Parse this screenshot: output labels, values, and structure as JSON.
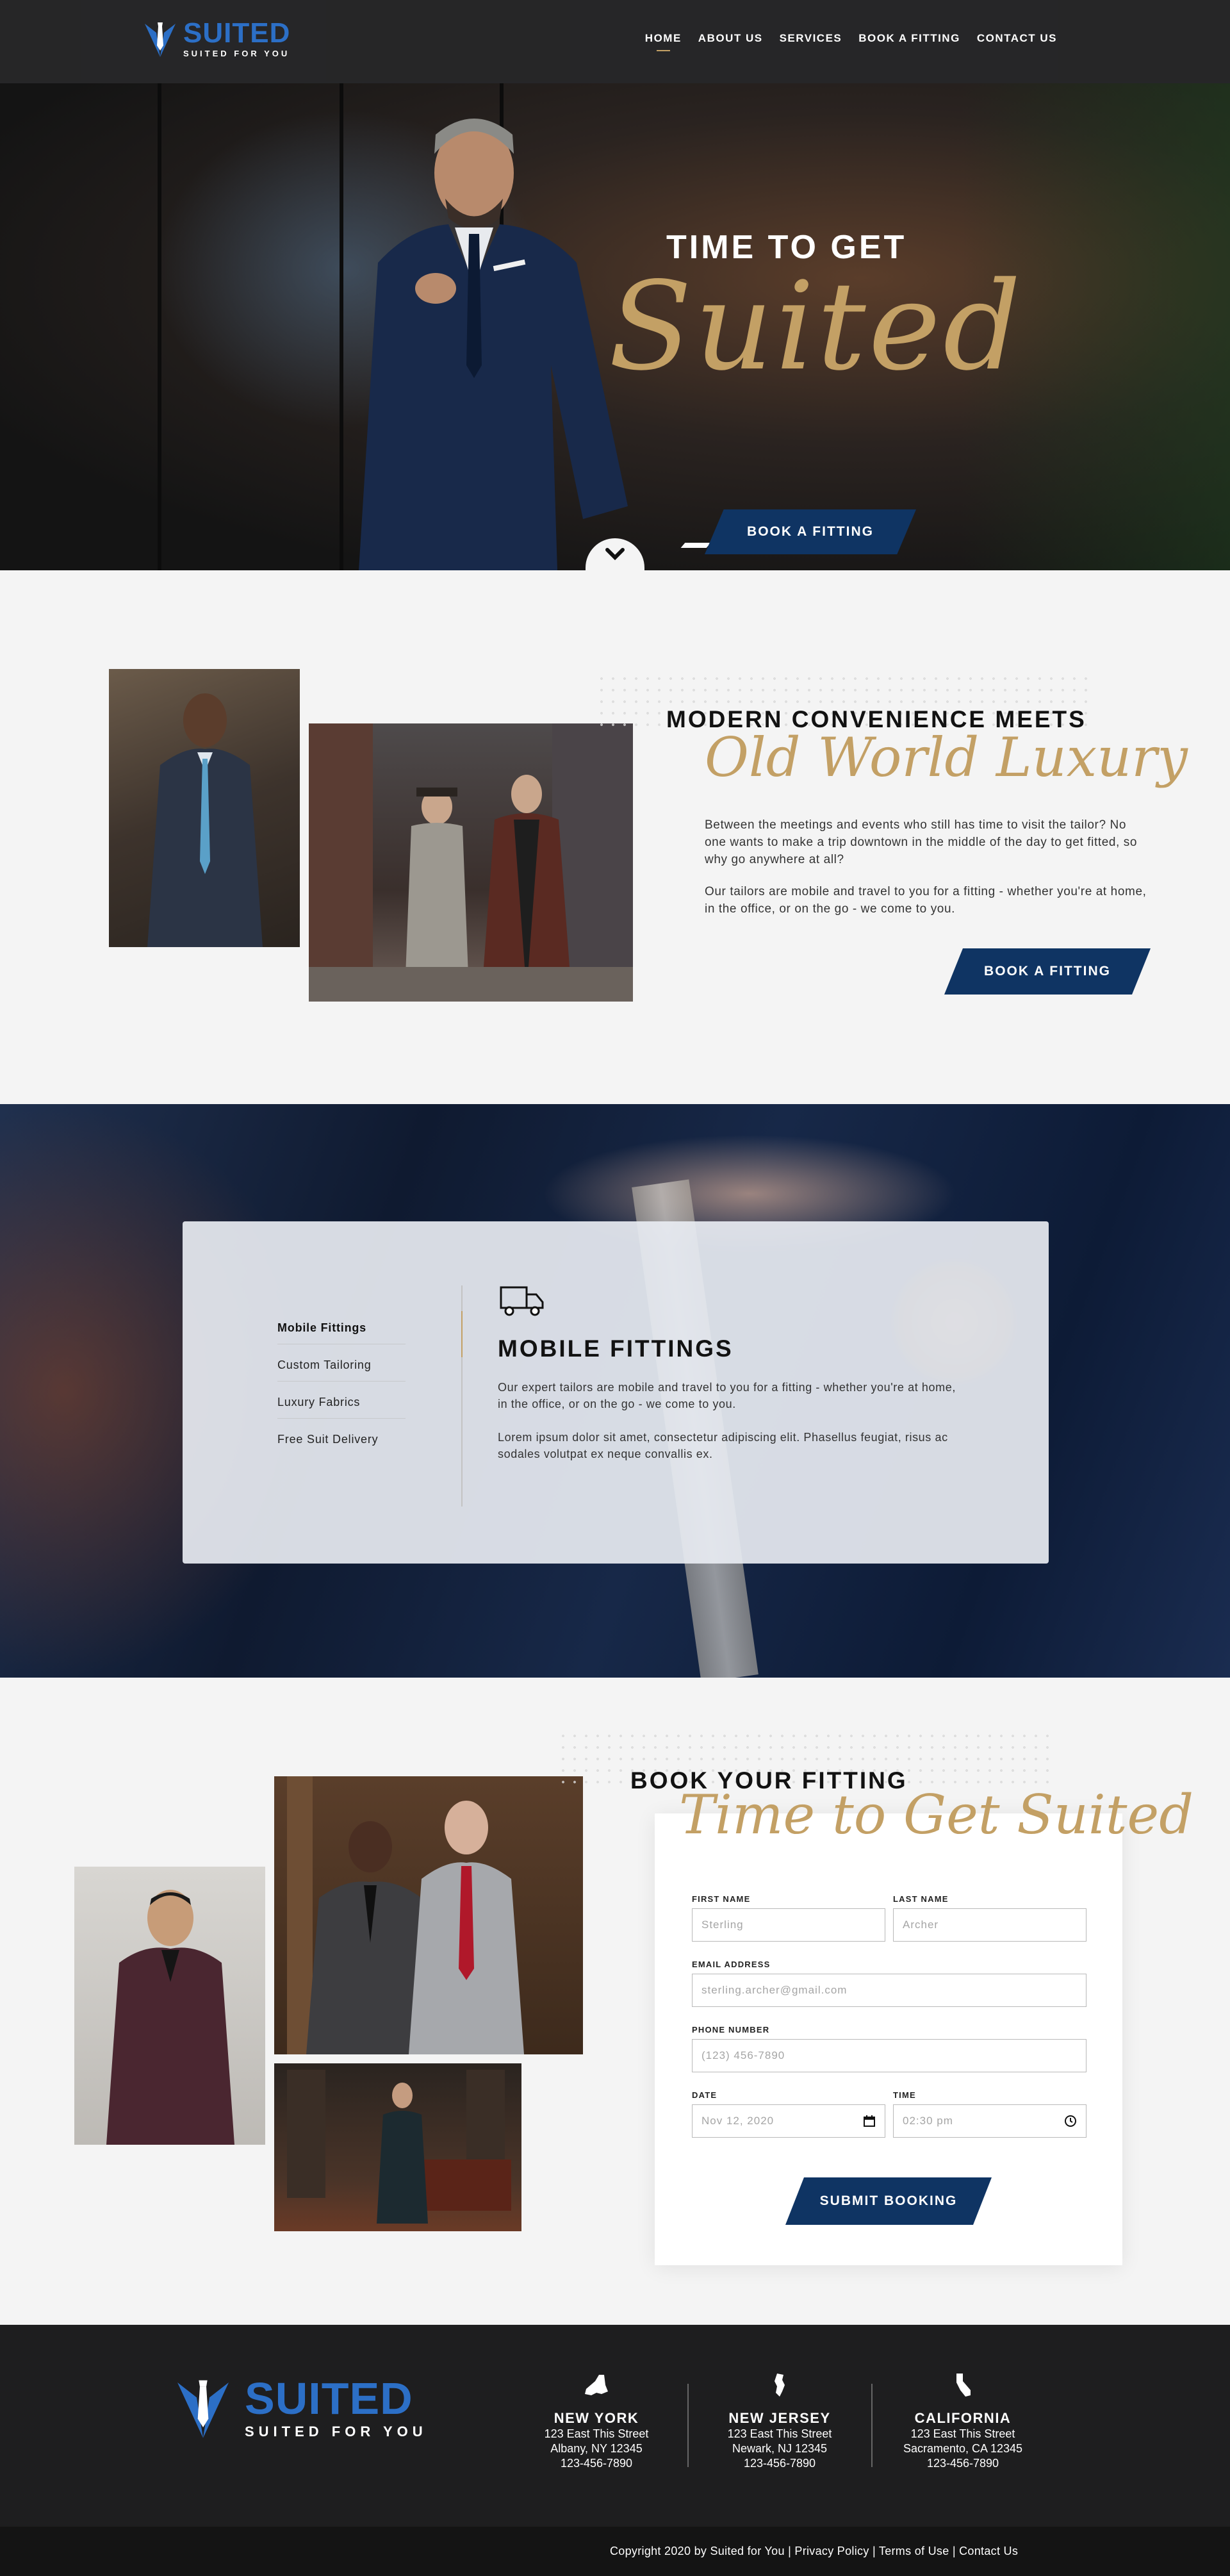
{
  "brand": {
    "name": "SUITED",
    "tagline": "SUITED FOR YOU"
  },
  "nav": {
    "links": [
      {
        "label": "HOME",
        "active": true
      },
      {
        "label": "ABOUT US",
        "active": false
      },
      {
        "label": "SERVICES",
        "active": false
      },
      {
        "label": "BOOK A FITTING",
        "active": false
      },
      {
        "label": "CONTACT US",
        "active": false
      }
    ]
  },
  "hero": {
    "title_top": "TIME  TO GET",
    "title_script": "Suited",
    "cta_label": "BOOK A FITTING",
    "scroll_icon": "chevron-down-icon"
  },
  "about": {
    "title": "MODERN CONVENIENCE MEETS",
    "script": "Old World Luxury",
    "para1": "Between the meetings and events who still has time to visit the tailor? No one wants to make a trip downtown in the middle of the day to get fitted, so why go anywhere at all?",
    "para2": "Our tailors are mobile and travel to you for a fitting - whether you're at home, in the office, or on the go - we come to you.",
    "cta_label": "BOOK A FITTING"
  },
  "services": {
    "tabs": [
      {
        "label": "Mobile Fittings",
        "active": true
      },
      {
        "label": "Custom Tailoring",
        "active": false
      },
      {
        "label": "Luxury Fabrics",
        "active": false
      },
      {
        "label": "Free Suit Delivery",
        "active": false
      }
    ],
    "active_icon": "truck-icon",
    "active_title": "MOBILE FITTINGS",
    "para1": "Our expert tailors are mobile and travel to you for a fitting - whether you're at home, in the office, or on the go - we come to you.",
    "para2": "Lorem ipsum dolor sit amet, consectetur adipiscing elit. Phasellus feugiat, risus ac sodales volutpat ex neque convallis ex."
  },
  "booking": {
    "title": "BOOK YOUR FITTING",
    "script": "Time to Get Suited",
    "fields": {
      "first_name": {
        "label": "FIRST NAME",
        "placeholder": "Sterling"
      },
      "last_name": {
        "label": "LAST NAME",
        "placeholder": "Archer"
      },
      "email": {
        "label": "EMAIL ADDRESS",
        "placeholder": "sterling.archer@gmail.com"
      },
      "phone": {
        "label": "PHONE NUMBER",
        "placeholder": "(123) 456-7890"
      },
      "date": {
        "label": "DATE",
        "placeholder": "Nov 12, 2020",
        "icon": "calendar-icon"
      },
      "time": {
        "label": "TIME",
        "placeholder": "02:30 pm",
        "icon": "clock-icon"
      }
    },
    "submit_label": "SUBMIT BOOKING"
  },
  "footer": {
    "locations": [
      {
        "name": "NEW YORK",
        "street": "123 East This Street",
        "city": "Albany, NY 12345",
        "phone": "123-456-7890",
        "icon": "new-york-state-icon"
      },
      {
        "name": "NEW JERSEY",
        "street": "123 East This Street",
        "city": "Newark, NJ 12345",
        "phone": "123-456-7890",
        "icon": "new-jersey-state-icon"
      },
      {
        "name": "CALIFORNIA",
        "street": "123 East This Street",
        "city": "Sacramento, CA 12345",
        "phone": "123-456-7890",
        "icon": "california-state-icon"
      }
    ],
    "copyright": "Copyright 2020 by Suited for You",
    "links": [
      "Privacy Policy",
      "Terms of Use",
      "Contact Us"
    ]
  },
  "colors": {
    "navy": "#0f3463",
    "gold": "#c3a065",
    "brand_blue": "#2c6fc6",
    "dark": "#1e1e1f"
  }
}
